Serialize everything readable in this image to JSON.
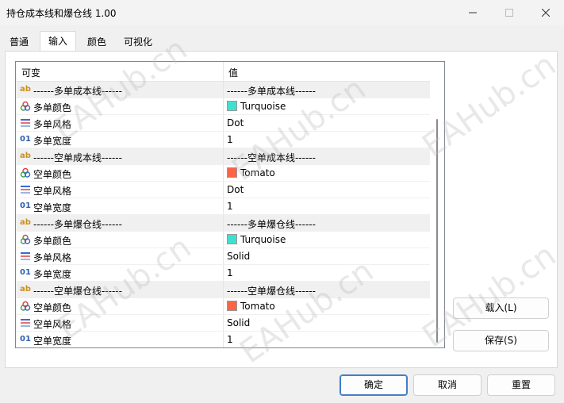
{
  "window": {
    "title": "持仓成本线和爆仓线 1.00"
  },
  "tabs": [
    {
      "label": "普通"
    },
    {
      "label": "输入"
    },
    {
      "label": "颜色"
    },
    {
      "label": "可视化"
    }
  ],
  "grid": {
    "header": {
      "col1": "可变",
      "col2": "值"
    },
    "rows": [
      {
        "icon": "ab",
        "name": "------多单成本线------",
        "value": "------多单成本线------",
        "section": true
      },
      {
        "icon": "color",
        "name": "多单颜色",
        "value": "Turquoise",
        "swatch": "#40e0d0"
      },
      {
        "icon": "style",
        "name": "多单风格",
        "value": "Dot"
      },
      {
        "icon": "01",
        "name": "多单宽度",
        "value": "1"
      },
      {
        "icon": "ab",
        "name": "------空单成本线------",
        "value": "------空单成本线------",
        "section": true
      },
      {
        "icon": "color",
        "name": "空单颜色",
        "value": "Tomato",
        "swatch": "#ff6347"
      },
      {
        "icon": "style",
        "name": "空单风格",
        "value": "Dot"
      },
      {
        "icon": "01",
        "name": "空单宽度",
        "value": "1"
      },
      {
        "icon": "ab",
        "name": "------多单爆仓线------",
        "value": "------多单爆仓线------",
        "section": true
      },
      {
        "icon": "color",
        "name": "多单颜色",
        "value": "Turquoise",
        "swatch": "#40e0d0"
      },
      {
        "icon": "style",
        "name": "多单风格",
        "value": "Solid"
      },
      {
        "icon": "01",
        "name": "多单宽度",
        "value": "1"
      },
      {
        "icon": "ab",
        "name": "------空单爆仓线------",
        "value": "------空单爆仓线------",
        "section": true
      },
      {
        "icon": "color",
        "name": "空单颜色",
        "value": "Tomato",
        "swatch": "#ff6347"
      },
      {
        "icon": "style",
        "name": "空单风格",
        "value": "Solid"
      },
      {
        "icon": "01",
        "name": "空单宽度",
        "value": "1"
      }
    ]
  },
  "side_buttons": {
    "load": "载入(L)",
    "save": "保存(S)"
  },
  "footer_buttons": {
    "ok": "确定",
    "cancel": "取消",
    "reset": "重置"
  },
  "watermark": "EAHub.cn"
}
